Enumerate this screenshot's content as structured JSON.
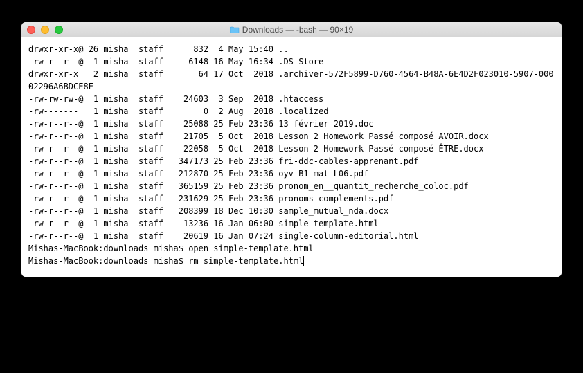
{
  "window": {
    "title": "Downloads — -bash — 90×19"
  },
  "ls": [
    {
      "perms": "drwxr-xr-x@",
      "links": "26",
      "owner": "misha",
      "group": "staff",
      "size": "832",
      "date": " 4 May 15:40",
      "name": ".."
    },
    {
      "perms": "-rw-r--r--@",
      "links": " 1",
      "owner": "misha",
      "group": "staff",
      "size": "6148",
      "date": "16 May 16:34",
      "name": ".DS_Store"
    },
    {
      "perms": "drwxr-xr-x ",
      "links": " 2",
      "owner": "misha",
      "group": "staff",
      "size": "64",
      "date": "17 Oct  2018",
      "name": ".archiver-572F5899-D760-4564-B48A-6E4D2F023010-5907-00002296A6BDCE8E"
    },
    {
      "perms": "-rw-rw-rw-@",
      "links": " 1",
      "owner": "misha",
      "group": "staff",
      "size": "24603",
      "date": " 3 Sep  2018",
      "name": ".htaccess"
    },
    {
      "perms": "-rw------- ",
      "links": " 1",
      "owner": "misha",
      "group": "staff",
      "size": "0",
      "date": " 2 Aug  2018",
      "name": ".localized"
    },
    {
      "perms": "-rw-r--r--@",
      "links": " 1",
      "owner": "misha",
      "group": "staff",
      "size": "25088",
      "date": "25 Feb 23:36",
      "name": "13 février 2019.doc"
    },
    {
      "perms": "-rw-r--r--@",
      "links": " 1",
      "owner": "misha",
      "group": "staff",
      "size": "21705",
      "date": " 5 Oct  2018",
      "name": "Lesson 2 Homework Passé composé AVOIR.docx"
    },
    {
      "perms": "-rw-r--r--@",
      "links": " 1",
      "owner": "misha",
      "group": "staff",
      "size": "22058",
      "date": " 5 Oct  2018",
      "name": "Lesson 2 Homework Passé composé ÊTRE.docx"
    },
    {
      "perms": "-rw-r--r--@",
      "links": " 1",
      "owner": "misha",
      "group": "staff",
      "size": "347173",
      "date": "25 Feb 23:36",
      "name": "fri-ddc-cables-apprenant.pdf"
    },
    {
      "perms": "-rw-r--r--@",
      "links": " 1",
      "owner": "misha",
      "group": "staff",
      "size": "212870",
      "date": "25 Feb 23:36",
      "name": "oyv-B1-mat-L06.pdf"
    },
    {
      "perms": "-rw-r--r--@",
      "links": " 1",
      "owner": "misha",
      "group": "staff",
      "size": "365159",
      "date": "25 Feb 23:36",
      "name": "pronom_en__quantit_recherche_coloc.pdf"
    },
    {
      "perms": "-rw-r--r--@",
      "links": " 1",
      "owner": "misha",
      "group": "staff",
      "size": "231629",
      "date": "25 Feb 23:36",
      "name": "pronoms_complements.pdf"
    },
    {
      "perms": "-rw-r--r--@",
      "links": " 1",
      "owner": "misha",
      "group": "staff",
      "size": "208399",
      "date": "18 Dec 10:30",
      "name": "sample_mutual_nda.docx"
    },
    {
      "perms": "-rw-r--r--@",
      "links": " 1",
      "owner": "misha",
      "group": "staff",
      "size": "13236",
      "date": "16 Jan 06:00",
      "name": "simple-template.html"
    },
    {
      "perms": "-rw-r--r--@",
      "links": " 1",
      "owner": "misha",
      "group": "staff",
      "size": "20619",
      "date": "16 Jan 07:24",
      "name": "single-column-editorial.html"
    }
  ],
  "prompt": {
    "host": "Mishas-MacBook",
    "dir": "downloads",
    "user": "misha",
    "sep": "$"
  },
  "commands": [
    "open simple-template.html",
    "rm simple-template.html"
  ]
}
